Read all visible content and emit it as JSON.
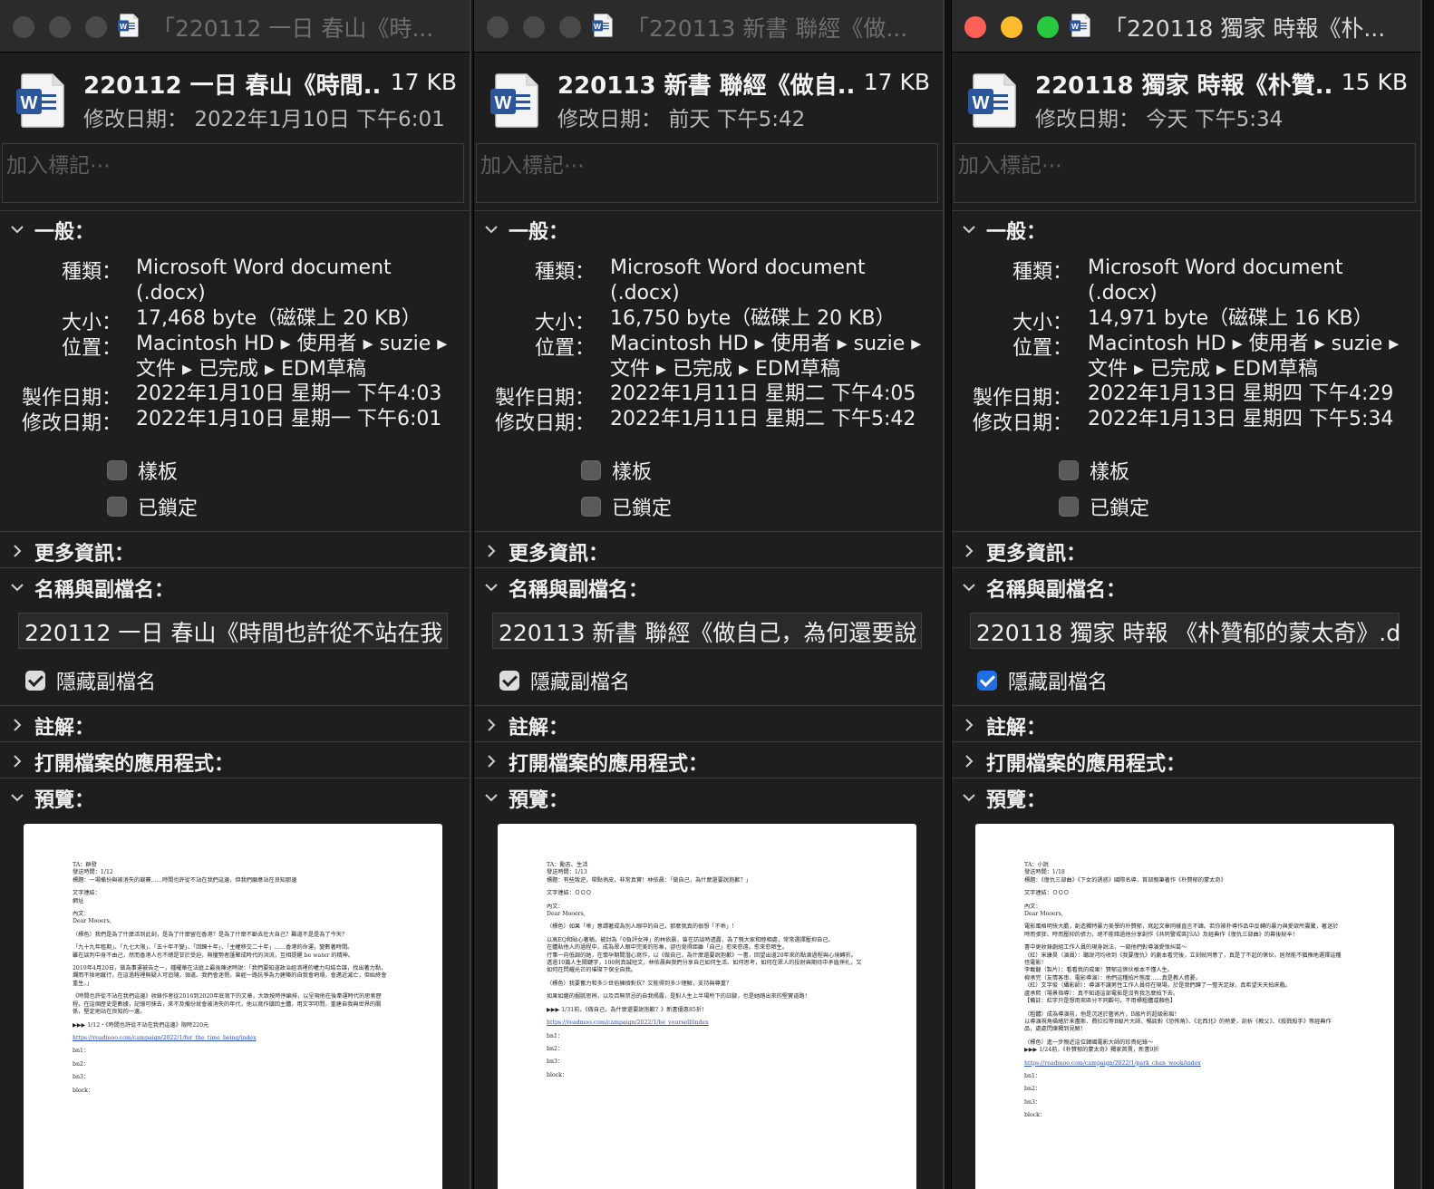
{
  "labels": {
    "tags_placeholder": "加入標記⋯",
    "general": "一般：",
    "kind": "種類：",
    "size": "大小：",
    "where": "位置：",
    "created": "製作日期：",
    "modified": "修改日期：",
    "stationery": "樣板",
    "locked": "已鎖定",
    "more_info": "更多資訊：",
    "name_ext": "名稱與副檔名：",
    "hide_ext": "隱藏副檔名",
    "comments": "註解：",
    "open_with": "打開檔案的應用程式：",
    "preview": "預覽：",
    "modified_prefix": "修改日期："
  },
  "windows": [
    {
      "title": "「220112 一日 春山《時...",
      "name": "220112 一日 春山《時間...",
      "filesize": "17 KB",
      "modified_short": "2022年1月10日 下午6:01",
      "kind_line1": "Microsoft Word document",
      "kind_line2": "(.docx)",
      "size": "17,468 byte（磁碟上 20 KB）",
      "where_line1": "Macintosh HD ▸ 使用者 ▸ suzie ▸",
      "where_line2": "文件 ▸ 已完成 ▸ EDM草稿",
      "created": "2022年1月10日 星期一 下午4:03",
      "modified": "2022年1月10日 星期一 下午6:01",
      "name_field": "220112 一日 春山《時間也許從不站在我",
      "preview": [
        "TA：群發\n發送時間：1/12\n標題：一場備份與被消失的競賽……時間也許從不站在我們這邊，但我們願意站在良知那邊",
        "文字連結：\n網址",
        "內文：\nDear Mooers,",
        "（標色）我們是為了什麼活到此刻，是為了什麼留在香港？是為了什麼不斷去壯大自己？難道不是是為了今天？",
        "「九十九年租期」、「九七大限」、「五十年不變」、「回歸十年」、「主權移交二十年」……香港的命運，變數著時間。\n雖在談判中身不由己，然而香港人也不總是甘於受迫，無懼勢者匯聚成時代的洪流，互相提醒 be water 的精神。",
        "2019年4月20日，做為事運被告之一，鍾耀華在法庭上最後陳述時說：「我們要知道政治經濟裡的權力勾結合謀，找出著力點，爛而不捨地蹴行，在這過程裡無疑人可追隨，領道。我們會迷惘，曾經一路抗爭為力建築的自我會坍塌，會邁近滅亡，但始終會重生。」",
        "《時間也許從不站在我們這邊》收錄作者從2016到2020年底寫下的文章，大致按時序編排，以呈現他在後牽運時代的思索歷程，在這個歷史是數據，記憶可抹去，來不及備份就會被消失的年代，他以寫作儲回主體，用文字叩問，重建自我與世界的關係，堅定地站在良知的一邊。",
        "▶▶▶ 1/12・《時間也許從不站在我們這邊》限時220元",
        "https://readmoo.com/campaign/2022/1/for_the_time_being/index",
        "bn1：",
        "bn2：",
        "bn3：",
        "block："
      ]
    },
    {
      "title": "「220113 新書 聯經《做...",
      "name": "220113 新書 聯經《做自...",
      "filesize": "17 KB",
      "modified_short": "前天 下午5:42",
      "kind_line1": "Microsoft Word document",
      "kind_line2": "(.docx)",
      "size": "16,750 byte（磁碟上 20 KB）",
      "where_line1": "Macintosh HD ▸ 使用者 ▸ suzie ▸",
      "where_line2": "文件 ▸ 已完成 ▸ EDM草稿",
      "created": "2022年1月11日 星期二 下午4:05",
      "modified": "2022年1月11日 星期二 下午5:42",
      "name_field": "220113 新書 聯經《做自己，為何還要說",
      "preview": [
        "TA：勵志、生活\n發送時間：1/13\n標題：有些叛逆，帶點俏皮，非常真實！林依晨：「做自己，為什麼還要說抱歉？」",
        "文字連結：ＯＯＯ",
        "內文：\nDear Mooers,",
        "（標色）如果「乖」意謂著成為別人眼中的自己，那麼我真的很想「不乖」！",
        "以高EQ和貼心著稱，被封為「0負評女神」的林依晨，曾在訪談時透露，為了親大家和睦相處，常常選擇壓抑自己。\n在體貼他人的過程中，成為眾人眼中完美的形象，卻也覺得距離「自己」愈來愈遠。愈來愈陌生。\n行事一向低調的她，在懷孕期間潛心寫作，以《做自己，為什麼還要說抱歉》一書，回望出道20年來的點滴過程與心境轉折。\n透過10篇人生關鍵字，100則真誠短文，林依晨與我們分享自己如何生活、如何思考，如何在眾人的投射與期待中矛盾掙扎，又如何在閃耀光芒的璀璨下保全自我。",
        "（標色）我要奮力和多少世俗擁擠對抗？又能得到多少理解，支持與尊重？",
        "如果如繼的掘腻思辨，以及百無禁忌的自我揭露，是對人生上半場所下的註腳，也是她踏出來的堅實道路！",
        "▶▶▶ 1/31前，《做自己，為什麼還要說抱歉？》新書優惠85折！",
        "https://readmoo.com/campaign/2022/1/be_yourself/index",
        "bn1：",
        "bn2：",
        "bn3：",
        "block："
      ]
    },
    {
      "title": "「220118 獨家 時報《朴...",
      "name": "220118 獨家 時報《朴贊...",
      "filesize": "15 KB",
      "modified_short": "今天 下午5:34",
      "kind_line1": "Microsoft Word document",
      "kind_line2": "(.docx)",
      "size": "14,971 byte（磁碟上 16 KB）",
      "where_line1": "Macintosh HD ▸ 使用者 ▸ suzie ▸",
      "where_line2": "文件 ▸ 已完成 ▸ EDM草稿",
      "created": "2022年1月13日 星期四 下午4:29",
      "modified": "2022年1月13日 星期四 下午5:34",
      "name_field": "220118 獨家 時報 《朴贊郁的蒙太奇》.d",
      "preview": [
        "TA：小說\n發送時間：1/18\n標題：《復仇三部曲》《下女的誘惑》國際名導，首部親筆著作《朴贊郁的蒙太奇》",
        "文字連結：ＯＯＯ",
        "內文：\nDear Mooers,",
        "電影風格明快大膽，創造獨特暴力美學的朴贊郁，寫起文章同樣直言不諱。若你被朴導作品中反轉的暴力與愛欲所震驚，著迷於時而張狂、時而壓抑的張力，絕不能錯過他分享創作《共同警戒區JSA》及經典作《復仇三部曲》的幕後秘辛！",
        "書中更收錄劇組工作人員的現身說法，一窺他們對導演愛恨糾葛～\n（紅）宋康昊（演員）：聽說河均收到《我要復仇》的劇本看完後，立刻就同意了，真是了不起的傢伙，居然能不猶豫地選擇這種怪電影！\n李載龍（製片）：看看我的成果！贊郁這傢伙根本不懂人生。\n柳承完（友情客串、電影導演）：他們這種拍片態度……真是教人擔憂。\n（紅）文字俊（攝影師）：導演不讓男性工作人員待在現場，於是我們蹲了一整天足球，真希望天天拍床戲。\n盧承熙（場景指導）：真不知道這部電影是沒有我怎麼拍下去。\n【備註：紅字只是想用來區分不同觀句，不用標粗體或顏色】",
        "（粗體）成為導演前，他是沉迷於藝術片，B級片的超級影痴！\n以導演視角描繪於未盡斯、費拉拉等B級片大師，暢談對《恐怖角》、《北西北》的熱愛，剖析《教父》、《殺戮殺手》等經典作品，處處閃爍獨到見解！",
        "（標色）進一步親近這位韓國電影大師的珍貴紀錄～\n▶▶▶ 1/24前，《朴贊郁的蒙太奇》獨家首賣，新書9折",
        "https://readmoo.com/campaign/2022/1/park_chan_wook/index",
        "bn1：",
        "bn2：",
        "bn3：",
        "block："
      ]
    }
  ]
}
